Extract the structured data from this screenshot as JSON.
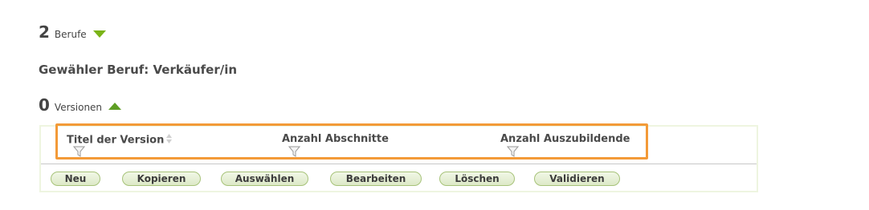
{
  "berufe": {
    "count": "2",
    "label": "Berufe"
  },
  "selected": {
    "text": "Gewähler Beruf: Verkäufer/in"
  },
  "versionen": {
    "count": "0",
    "label": "Versionen"
  },
  "table": {
    "columns": [
      "Titel der Version",
      "Anzahl Abschnitte",
      "Anzahl Auszubildende"
    ]
  },
  "buttons": [
    "Neu",
    "Kopieren",
    "Auswählen",
    "Bearbeiten",
    "Löschen",
    "Validieren"
  ],
  "colors": {
    "accent": "#7ab317",
    "highlight": "#f39a38",
    "button_border": "#a7c37a"
  }
}
